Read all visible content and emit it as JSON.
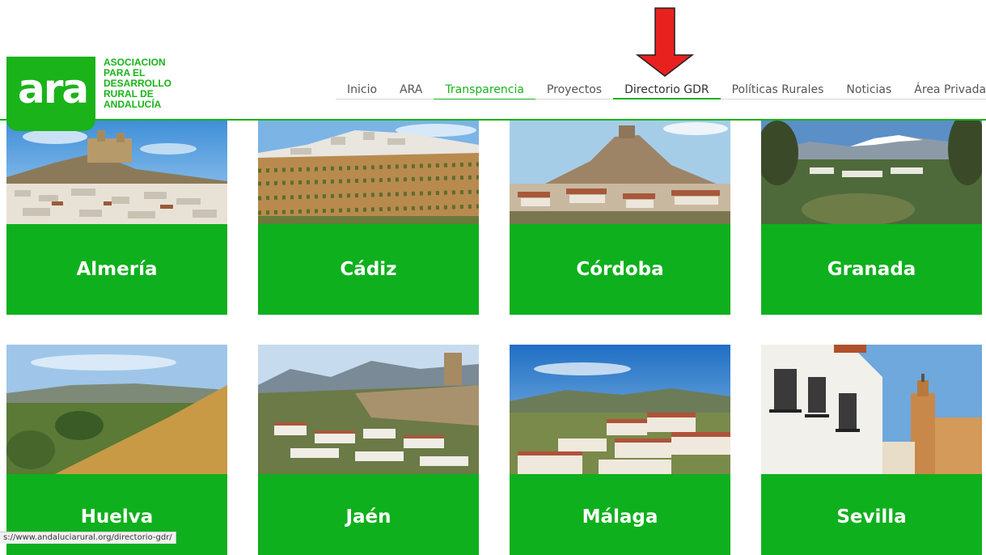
{
  "logo": {
    "mark": "ara",
    "lines": [
      "ASOCIACION",
      "PARA EL",
      "DESARROLLO",
      "RURAL DE",
      "ANDALUCÍA"
    ]
  },
  "nav": {
    "items": [
      "Inicio",
      "ARA",
      "Transparencia",
      "Proyectos",
      "Directorio GDR",
      "Políticas Rurales",
      "Noticias",
      "Área Privada"
    ]
  },
  "provinces": [
    "Almería",
    "Cádiz",
    "Córdoba",
    "Granada",
    "Huelva",
    "Jaén",
    "Málaga",
    "Sevilla"
  ],
  "status_bar": {
    "url": "s://www.andaluciarural.org/directorio-gdr/"
  },
  "colors": {
    "brand_green": "#1ab31a",
    "card_green": "#0fb01d",
    "arrow_red": "#e8211f"
  }
}
